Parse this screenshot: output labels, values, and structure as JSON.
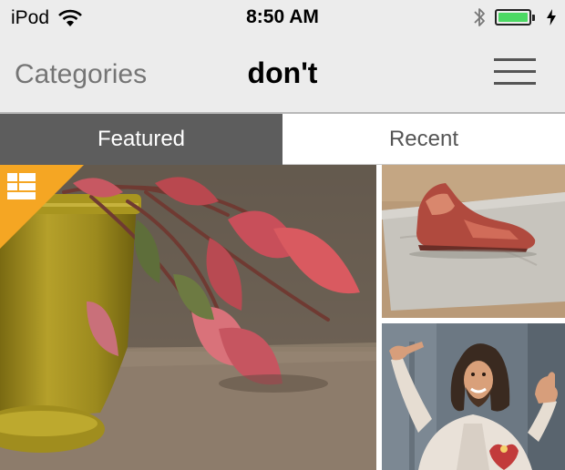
{
  "status_bar": {
    "carrier": "iPod",
    "time": "8:50 AM",
    "wifi_icon": "wifi-icon",
    "bluetooth_icon": "bluetooth-icon",
    "battery_icon": "battery-icon",
    "battery_level": 1.0,
    "charging_icon": "charging-bolt-icon"
  },
  "nav": {
    "back_label": "Categories",
    "title": "don't",
    "menu_icon": "hamburger-menu-icon"
  },
  "tabs": [
    {
      "label": "Featured",
      "selected": true
    },
    {
      "label": "Recent",
      "selected": false
    }
  ],
  "photos": [
    {
      "name": "plant-photo",
      "badge": "featured-badge-icon"
    },
    {
      "name": "shoe-photo"
    },
    {
      "name": "statue-photo"
    }
  ],
  "colors": {
    "bar_background": "#ececec",
    "tab_selected": "#5d5d5d",
    "badge": "#f5a623",
    "battery": "#4cd964"
  }
}
